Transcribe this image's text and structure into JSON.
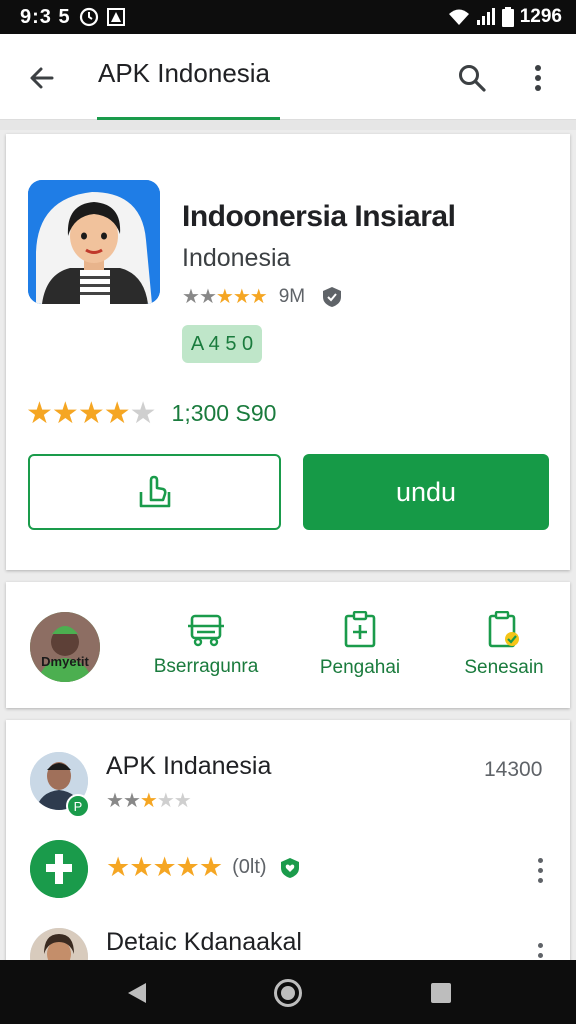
{
  "status_bar": {
    "time": "9:3 5",
    "right_text": "1296",
    "icons": [
      "alarm-icon",
      "notification-icon",
      "wifi-icon",
      "signal-icon",
      "battery-icon"
    ]
  },
  "app_bar": {
    "title": "APK Indonesia",
    "icons": [
      "back-arrow-icon",
      "search-icon",
      "more-vert-icon"
    ]
  },
  "app": {
    "name": "Indoonersia Insiaral",
    "developer": "Indonesia",
    "size": "9M",
    "small_rating": 3,
    "badge": "A 4 5 0",
    "rating": 3.5,
    "rating_count": "1;300 S90",
    "install_label": "undu",
    "colors": {
      "accent": "#169a47",
      "star": "#f5a623",
      "icon_bg": "#1f7de6"
    }
  },
  "shortcuts": [
    {
      "label": "Dmyetit",
      "icon": "avatar-icon"
    },
    {
      "label": "Bserragunra",
      "icon": "truck-icon"
    },
    {
      "label": "Pengahai",
      "icon": "clipboard-add-icon"
    },
    {
      "label": "Senesain",
      "icon": "device-check-icon"
    }
  ],
  "list": [
    {
      "title": "APK Indanesia",
      "count": "14300",
      "rating": 2.5,
      "icon": "person-avatar"
    },
    {
      "title": "",
      "rating": 5,
      "rating_text": "(0lt)",
      "icon": "plus-cross-icon"
    },
    {
      "title": "Detaic Kdanaakal",
      "icon": "person-avatar"
    }
  ]
}
